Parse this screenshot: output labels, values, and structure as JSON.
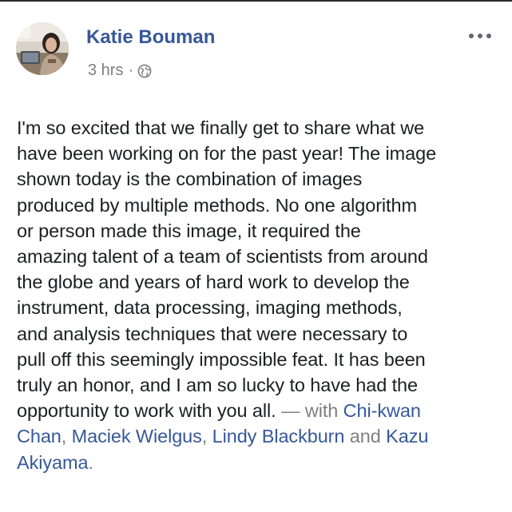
{
  "post": {
    "author": "Katie Bouman",
    "timestamp": "3 hrs",
    "separator": "·",
    "privacy_icon": "globe-icon",
    "more_icon": "more-options-icon",
    "body_lines": [
      "I'm so excited that we finally get to share what we",
      "have been working on for the past year! The image",
      "shown today is the combination of images",
      "produced by multiple methods. No one algorithm",
      "or person made this image, it required the",
      "amazing talent of a team of scientists from around",
      "the globe and years of hard work to develop the",
      "instrument, data processing, imaging methods,",
      "and analysis techniques that were necessary to",
      "pull off this seemingly impossible feat. It has been",
      "truly an honor, and I am so lucky to have had the"
    ],
    "last_line_text": "opportunity to work with you all.",
    "with_text": " — with ",
    "tags": [
      "Chi-kwan Chan",
      "Maciek Wielgus",
      "Lindy Blackburn",
      "Kazu Akiyama"
    ],
    "tag_first_part": "Chi-kwan",
    "tag_first_rest": "Chan",
    "comma": ", ",
    "and_text": " and ",
    "tag_last_part": "Kazu",
    "tag_last_rest": "Akiyama",
    "period": "."
  },
  "colors": {
    "link": "#365899",
    "text": "#1c1e21",
    "meta": "#7f7f7f",
    "background": "#ffffff"
  }
}
